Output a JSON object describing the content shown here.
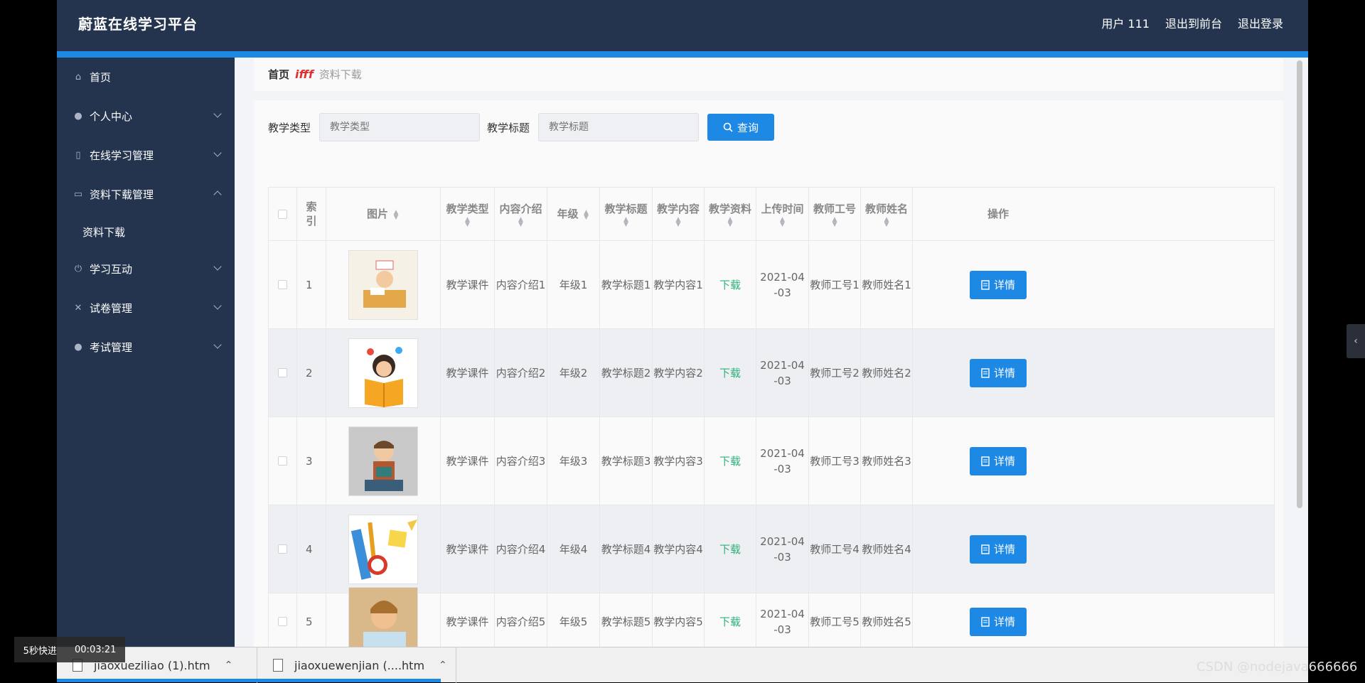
{
  "app": {
    "title": "蔚蓝在线学习平台",
    "user": "用户 111",
    "to_front": "退出到前台",
    "logout": "退出登录"
  },
  "sidebar": {
    "items": [
      {
        "label": "首页",
        "icon": "home-icon"
      },
      {
        "label": "个人中心",
        "icon": "user-icon"
      },
      {
        "label": "在线学习管理",
        "icon": "book-icon"
      },
      {
        "label": "资料下载管理",
        "icon": "folder-icon",
        "expanded": true
      },
      {
        "label": "学习互动",
        "icon": "power-icon"
      },
      {
        "label": "试卷管理",
        "icon": "bell-off-icon"
      },
      {
        "label": "考试管理",
        "icon": "user-icon"
      }
    ],
    "submenu": {
      "label": "资料下载"
    }
  },
  "breadcrumb": {
    "home": "首页",
    "separator": "ifff",
    "current": "资料下载"
  },
  "search": {
    "type_label": "教学类型",
    "type_placeholder": "教学类型",
    "title_label": "教学标题",
    "title_placeholder": "教学标题",
    "button": "查询"
  },
  "table": {
    "headers": [
      "索引",
      "图片",
      "教学类型",
      "内容介绍",
      "年级",
      "教学标题",
      "教学内容",
      "教学资料",
      "上传时间",
      "教师工号",
      "教师姓名",
      "操作"
    ],
    "rows": [
      {
        "index": "1",
        "type": "教学课件",
        "intro": "内容介绍1",
        "grade": "年级1",
        "title": "教学标题1",
        "content": "教学内容1",
        "material": "下载",
        "date": "2021-04-03",
        "teacher_id": "教师工号1",
        "teacher_name": "教师姓名1",
        "action": "详情"
      },
      {
        "index": "2",
        "type": "教学课件",
        "intro": "内容介绍2",
        "grade": "年级2",
        "title": "教学标题2",
        "content": "教学内容2",
        "material": "下载",
        "date": "2021-04-03",
        "teacher_id": "教师工号2",
        "teacher_name": "教师姓名2",
        "action": "详情"
      },
      {
        "index": "3",
        "type": "教学课件",
        "intro": "内容介绍3",
        "grade": "年级3",
        "title": "教学标题3",
        "content": "教学内容3",
        "material": "下载",
        "date": "2021-04-03",
        "teacher_id": "教师工号3",
        "teacher_name": "教师姓名3",
        "action": "详情"
      },
      {
        "index": "4",
        "type": "教学课件",
        "intro": "内容介绍4",
        "grade": "年级4",
        "title": "教学标题4",
        "content": "教学内容4",
        "material": "下载",
        "date": "2021-04-03",
        "teacher_id": "教师工号4",
        "teacher_name": "教师姓名4",
        "action": "详情"
      },
      {
        "index": "5",
        "type": "教学课件",
        "intro": "内容介绍5",
        "grade": "年级5",
        "title": "教学标题5",
        "content": "教学内容5",
        "material": "下载",
        "date": "2021-04-03",
        "teacher_id": "教师工号5",
        "teacher_name": "教师姓名5",
        "action": "详情"
      }
    ]
  },
  "downloads": [
    {
      "name": "jiaoxueziliao (1).htm"
    },
    {
      "name": "jiaoxuewenjian (....htm"
    }
  ],
  "video": {
    "speed": "5秒快进",
    "time": "00:03:21"
  },
  "watermark": "CSDN @nodejava666666",
  "colors": {
    "header": "#24344e",
    "accent": "#1e88e5",
    "download": "#2db37a"
  }
}
